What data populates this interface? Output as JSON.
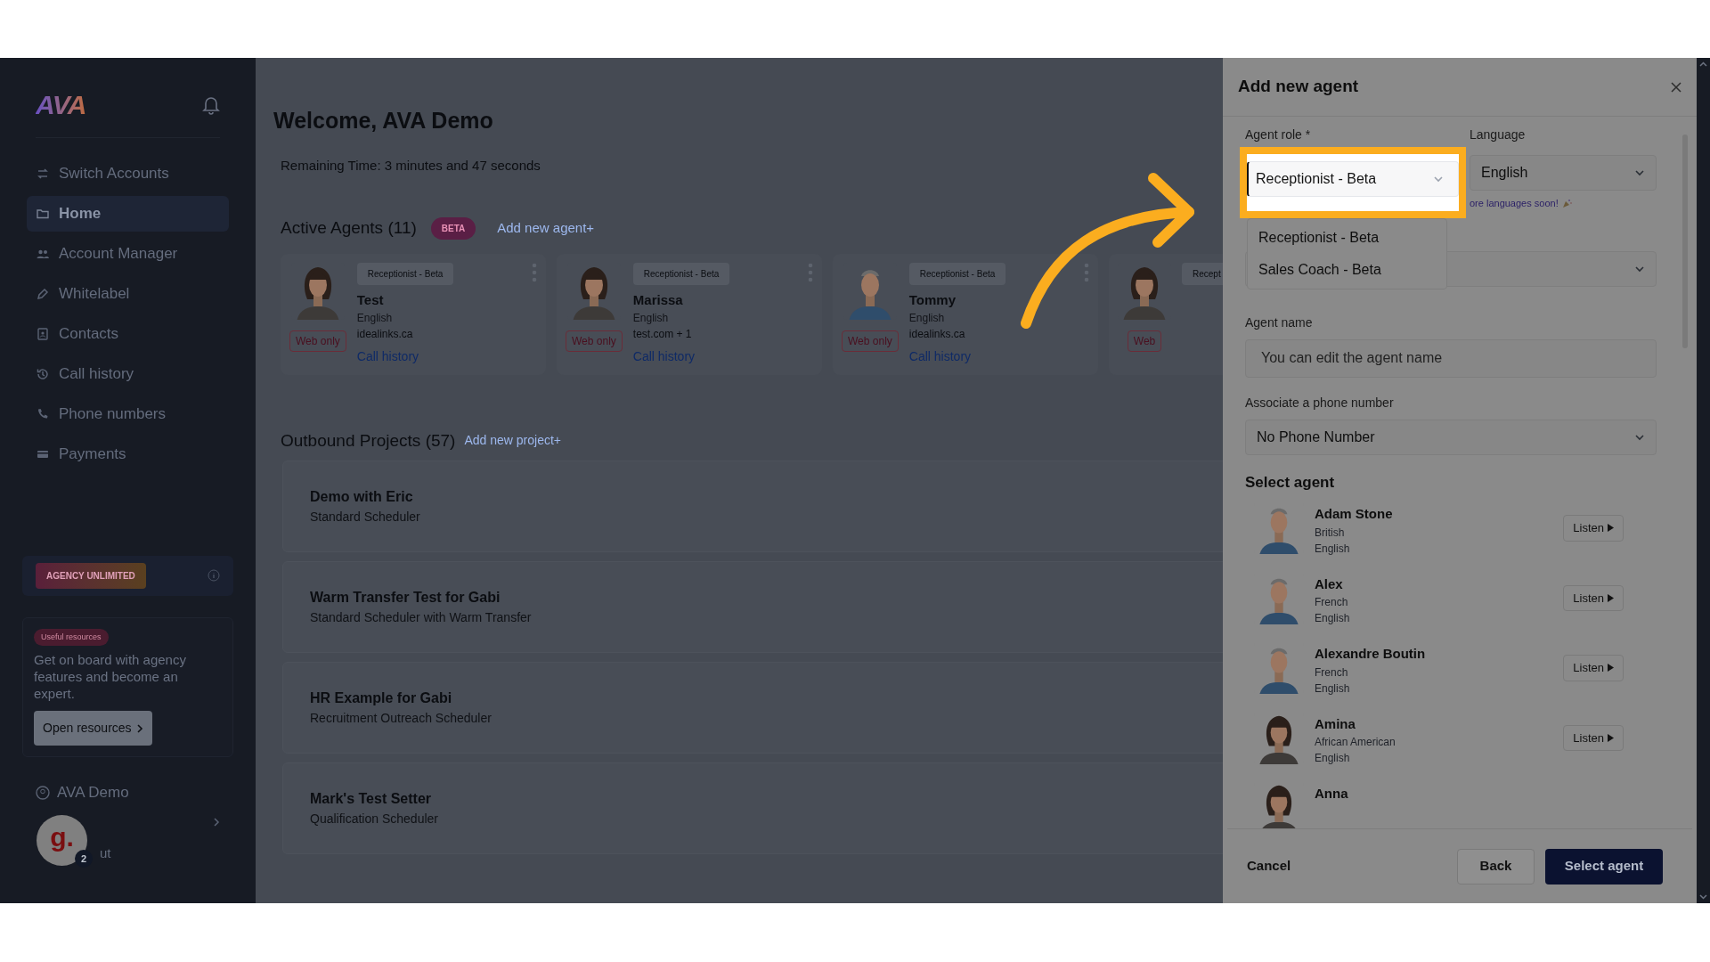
{
  "sidebar": {
    "logo": "AVA",
    "nav": [
      {
        "label": "Switch Accounts",
        "selected": false
      },
      {
        "label": "Home",
        "selected": true
      },
      {
        "label": "Account Manager",
        "selected": false
      },
      {
        "label": "Whitelabel",
        "selected": false
      },
      {
        "label": "Contacts",
        "selected": false
      },
      {
        "label": "Call history",
        "selected": false
      },
      {
        "label": "Phone numbers",
        "selected": false
      },
      {
        "label": "Payments",
        "selected": false
      }
    ],
    "plan_badge": "AGENCY UNLIMITED",
    "resources": {
      "tag": "Useful resources",
      "text": "Get on board with agency features and become an expert.",
      "button": "Open resources"
    },
    "user": "AVA Demo",
    "logout_fragment": "ut"
  },
  "chat_widget": {
    "letter": "g.",
    "badge": "2"
  },
  "main": {
    "title": "Welcome, AVA Demo",
    "remaining": "Remaining Time: 3 minutes and 47 seconds",
    "active_agents": {
      "heading": "Active Agents (11)",
      "badge": "BETA",
      "link": "Add new agent+",
      "cards": [
        {
          "role": "Receptionist - Beta",
          "name": "Test",
          "language": "English",
          "domain": "idealinks.ca",
          "button": "Web only",
          "link": "Call history"
        },
        {
          "role": "Receptionist - Beta",
          "name": "Marissa",
          "language": "English",
          "domain": "test.com + 1",
          "button": "Web only",
          "link": "Call history"
        },
        {
          "role": "Receptionist - Beta",
          "name": "Tommy",
          "language": "English",
          "domain": "idealinks.ca",
          "button": "Web only",
          "link": "Call history"
        },
        {
          "role": "Recept",
          "button": "Web"
        }
      ]
    },
    "outbound": {
      "heading": "Outbound Projects (57)",
      "link": "Add new project+",
      "projects": [
        {
          "title": "Demo with Eric",
          "subtitle": "Standard Scheduler"
        },
        {
          "title": "Warm Transfer Test for Gabi",
          "subtitle": "Standard Scheduler with Warm Transfer"
        },
        {
          "title": "HR Example for Gabi",
          "subtitle": "Recruitment Outreach Scheduler"
        },
        {
          "title": "Mark's Test Setter",
          "subtitle": "Qualification Scheduler"
        }
      ]
    }
  },
  "dialog": {
    "title": "Add new agent",
    "role_label": "Agent role *",
    "role_value": "Receptionist - Beta",
    "role_options": [
      "Receptionist - Beta",
      "Sales Coach - Beta"
    ],
    "language_label": "Language",
    "language_value": "English",
    "language_hint": "ore languages soon!",
    "agent_name_label": "Agent name",
    "agent_name_placeholder": "You can edit the agent name",
    "phone_label": "Associate a phone number",
    "phone_value": "No Phone Number",
    "select_heading": "Select agent",
    "agents": [
      {
        "name": "Adam Stone",
        "accent": "British",
        "language": "English",
        "listen": "Listen"
      },
      {
        "name": "Alex",
        "accent": "French",
        "language": "English",
        "listen": "Listen"
      },
      {
        "name": "Alexandre Boutin",
        "accent": "French",
        "language": "English",
        "listen": "Listen"
      },
      {
        "name": "Amina",
        "accent": "African American",
        "language": "English",
        "listen": "Listen"
      },
      {
        "name": "Anna"
      }
    ],
    "cancel": "Cancel",
    "back": "Back",
    "confirm": "Select agent"
  }
}
